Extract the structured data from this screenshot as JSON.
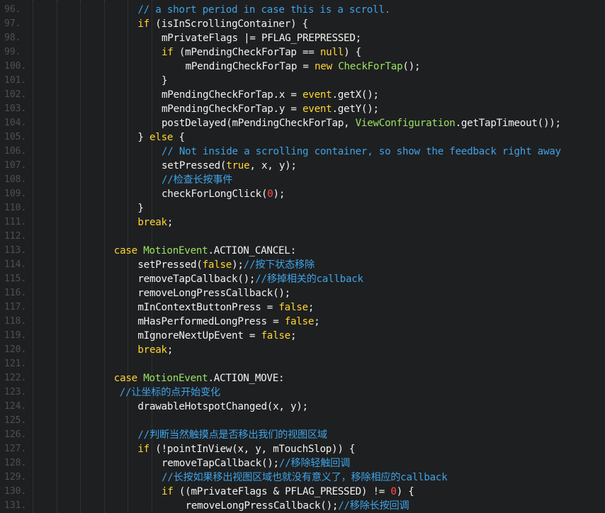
{
  "editor": {
    "lines": [
      {
        "num": "96.",
        "indent": 4,
        "segments": [
          {
            "t": "// a short period in case this is a scroll.",
            "c": "cmt"
          }
        ]
      },
      {
        "num": "97.",
        "indent": 4,
        "segments": [
          {
            "t": "if",
            "c": "kw"
          },
          {
            "t": " (isInScrollingContainer) {",
            "c": "plain"
          }
        ]
      },
      {
        "num": "98.",
        "indent": 5,
        "segments": [
          {
            "t": "mPrivateFlags |= PFLAG_PREPRESSED;",
            "c": "plain"
          }
        ]
      },
      {
        "num": "99.",
        "indent": 5,
        "segments": [
          {
            "t": "if",
            "c": "kw"
          },
          {
            "t": " (mPendingCheckForTap == ",
            "c": "plain"
          },
          {
            "t": "null",
            "c": "kw"
          },
          {
            "t": ") {",
            "c": "plain"
          }
        ]
      },
      {
        "num": "100.",
        "indent": 6,
        "segments": [
          {
            "t": "mPendingCheckForTap = ",
            "c": "plain"
          },
          {
            "t": "new",
            "c": "kw"
          },
          {
            "t": " ",
            "c": "plain"
          },
          {
            "t": "CheckForTap",
            "c": "cls"
          },
          {
            "t": "();",
            "c": "plain"
          }
        ]
      },
      {
        "num": "101.",
        "indent": 5,
        "segments": [
          {
            "t": "}",
            "c": "plain"
          }
        ]
      },
      {
        "num": "102.",
        "indent": 5,
        "segments": [
          {
            "t": "mPendingCheckForTap.x = ",
            "c": "plain"
          },
          {
            "t": "event",
            "c": "kw"
          },
          {
            "t": ".getX();",
            "c": "plain"
          }
        ]
      },
      {
        "num": "103.",
        "indent": 5,
        "segments": [
          {
            "t": "mPendingCheckForTap.y = ",
            "c": "plain"
          },
          {
            "t": "event",
            "c": "kw"
          },
          {
            "t": ".getY();",
            "c": "plain"
          }
        ]
      },
      {
        "num": "104.",
        "indent": 5,
        "segments": [
          {
            "t": "postDelayed(mPendingCheckForTap, ",
            "c": "plain"
          },
          {
            "t": "ViewConfiguration",
            "c": "cls"
          },
          {
            "t": ".getTapTimeout());",
            "c": "plain"
          }
        ]
      },
      {
        "num": "105.",
        "indent": 4,
        "segments": [
          {
            "t": "} ",
            "c": "plain"
          },
          {
            "t": "else",
            "c": "kw"
          },
          {
            "t": " {",
            "c": "plain"
          }
        ]
      },
      {
        "num": "106.",
        "indent": 5,
        "segments": [
          {
            "t": "// Not inside a scrolling container, so show the feedback right away",
            "c": "cmt"
          }
        ]
      },
      {
        "num": "107.",
        "indent": 5,
        "segments": [
          {
            "t": "setPressed(",
            "c": "plain"
          },
          {
            "t": "true",
            "c": "kw"
          },
          {
            "t": ", x, y);",
            "c": "plain"
          }
        ]
      },
      {
        "num": "108.",
        "indent": 5,
        "segments": [
          {
            "t": "//检查长按事件",
            "c": "cmt"
          }
        ]
      },
      {
        "num": "109.",
        "indent": 5,
        "segments": [
          {
            "t": "checkForLongClick(",
            "c": "plain"
          },
          {
            "t": "0",
            "c": "num"
          },
          {
            "t": ");",
            "c": "plain"
          }
        ]
      },
      {
        "num": "110.",
        "indent": 4,
        "segments": [
          {
            "t": "}",
            "c": "plain"
          }
        ]
      },
      {
        "num": "111.",
        "indent": 4,
        "segments": [
          {
            "t": "break",
            "c": "kw"
          },
          {
            "t": ";",
            "c": "plain"
          }
        ]
      },
      {
        "num": "112.",
        "indent": 0,
        "segments": []
      },
      {
        "num": "113.",
        "indent": 3,
        "segments": [
          {
            "t": "case",
            "c": "kw"
          },
          {
            "t": " ",
            "c": "plain"
          },
          {
            "t": "MotionEvent",
            "c": "cls"
          },
          {
            "t": ".ACTION_CANCEL:",
            "c": "plain"
          }
        ]
      },
      {
        "num": "114.",
        "indent": 4,
        "segments": [
          {
            "t": "setPressed(",
            "c": "plain"
          },
          {
            "t": "false",
            "c": "kw"
          },
          {
            "t": ");",
            "c": "plain"
          },
          {
            "t": "//按下状态移除",
            "c": "cmt"
          }
        ]
      },
      {
        "num": "115.",
        "indent": 4,
        "segments": [
          {
            "t": "removeTapCallback();",
            "c": "plain"
          },
          {
            "t": "//移掉相关的callback",
            "c": "cmt"
          }
        ]
      },
      {
        "num": "116.",
        "indent": 4,
        "segments": [
          {
            "t": "removeLongPressCallback();",
            "c": "plain"
          }
        ]
      },
      {
        "num": "117.",
        "indent": 4,
        "segments": [
          {
            "t": "mInContextButtonPress = ",
            "c": "plain"
          },
          {
            "t": "false",
            "c": "kw"
          },
          {
            "t": ";",
            "c": "plain"
          }
        ]
      },
      {
        "num": "118.",
        "indent": 4,
        "segments": [
          {
            "t": "mHasPerformedLongPress = ",
            "c": "plain"
          },
          {
            "t": "false",
            "c": "kw"
          },
          {
            "t": ";",
            "c": "plain"
          }
        ]
      },
      {
        "num": "119.",
        "indent": 4,
        "segments": [
          {
            "t": "mIgnoreNextUpEvent = ",
            "c": "plain"
          },
          {
            "t": "false",
            "c": "kw"
          },
          {
            "t": ";",
            "c": "plain"
          }
        ]
      },
      {
        "num": "120.",
        "indent": 4,
        "segments": [
          {
            "t": "break",
            "c": "kw"
          },
          {
            "t": ";",
            "c": "plain"
          }
        ]
      },
      {
        "num": "121.",
        "indent": 0,
        "segments": []
      },
      {
        "num": "122.",
        "indent": 3,
        "segments": [
          {
            "t": "case",
            "c": "kw"
          },
          {
            "t": " ",
            "c": "plain"
          },
          {
            "t": "MotionEvent",
            "c": "cls"
          },
          {
            "t": ".ACTION_MOVE:",
            "c": "plain"
          }
        ]
      },
      {
        "num": "123.",
        "indent": 3,
        "extra": 1,
        "segments": [
          {
            "t": "//让坐标的点开始变化",
            "c": "cmt"
          }
        ]
      },
      {
        "num": "124.",
        "indent": 4,
        "segments": [
          {
            "t": "drawableHotspotChanged(x, y);",
            "c": "plain"
          }
        ]
      },
      {
        "num": "125.",
        "indent": 0,
        "segments": []
      },
      {
        "num": "126.",
        "indent": 4,
        "segments": [
          {
            "t": "//判断当然触摸点是否移出我们的视图区域",
            "c": "cmt"
          }
        ]
      },
      {
        "num": "127.",
        "indent": 4,
        "segments": [
          {
            "t": "if",
            "c": "kw"
          },
          {
            "t": " (!pointInView(x, y, mTouchSlop)) {",
            "c": "plain"
          }
        ]
      },
      {
        "num": "128.",
        "indent": 5,
        "segments": [
          {
            "t": "removeTapCallback();",
            "c": "plain"
          },
          {
            "t": "//移除轻触回调",
            "c": "cmt"
          }
        ]
      },
      {
        "num": "129.",
        "indent": 5,
        "segments": [
          {
            "t": "//长按如果移出视图区域也就没有意义了，移除相应的callback",
            "c": "cmt"
          }
        ]
      },
      {
        "num": "130.",
        "indent": 5,
        "segments": [
          {
            "t": "if",
            "c": "kw"
          },
          {
            "t": " ((mPrivateFlags & PFLAG_PRESSED) != ",
            "c": "plain"
          },
          {
            "t": "0",
            "c": "num"
          },
          {
            "t": ") {",
            "c": "plain"
          }
        ]
      },
      {
        "num": "131.",
        "indent": 6,
        "segments": [
          {
            "t": "removeLongPressCallback();",
            "c": "plain"
          },
          {
            "t": "//移除长按回调",
            "c": "cmt"
          }
        ]
      }
    ]
  },
  "colors": {
    "background": "#1e1f21",
    "line_number": "#4f5052",
    "text": "#f2f2f0",
    "keyword": "#ffd630",
    "class_name": "#9ce35f",
    "comment": "#3fa3e5",
    "number": "#ff4a4a"
  }
}
